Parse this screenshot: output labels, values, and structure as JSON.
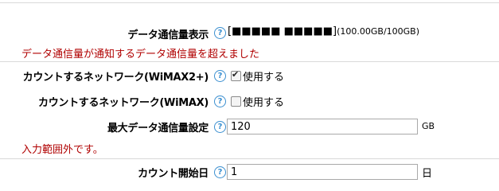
{
  "data_usage": {
    "label": "データ通信量表示",
    "meter": "[■■■■■ ■■■■■]",
    "amount": "(100.00GB/100GB)",
    "warning": "データ通信量が通知するデータ通信量を超えました"
  },
  "count_wimax2": {
    "label": "カウントするネットワーク(WiMAX2+)",
    "option_label": "使用する",
    "checked": true
  },
  "count_wimax": {
    "label": "カウントするネットワーク(WiMAX)",
    "option_label": "使用する",
    "checked": false
  },
  "max_usage": {
    "label": "最大データ通信量設定",
    "value": "120",
    "unit": "GB",
    "error": "入力範囲外です。"
  },
  "count_start_day": {
    "label": "カウント開始日",
    "value": "1",
    "unit": "日"
  },
  "help_glyph": "?",
  "colors": {
    "help_icon": "#3a8fd0",
    "error_text": "#b00000",
    "divider": "#d9d9d9"
  }
}
